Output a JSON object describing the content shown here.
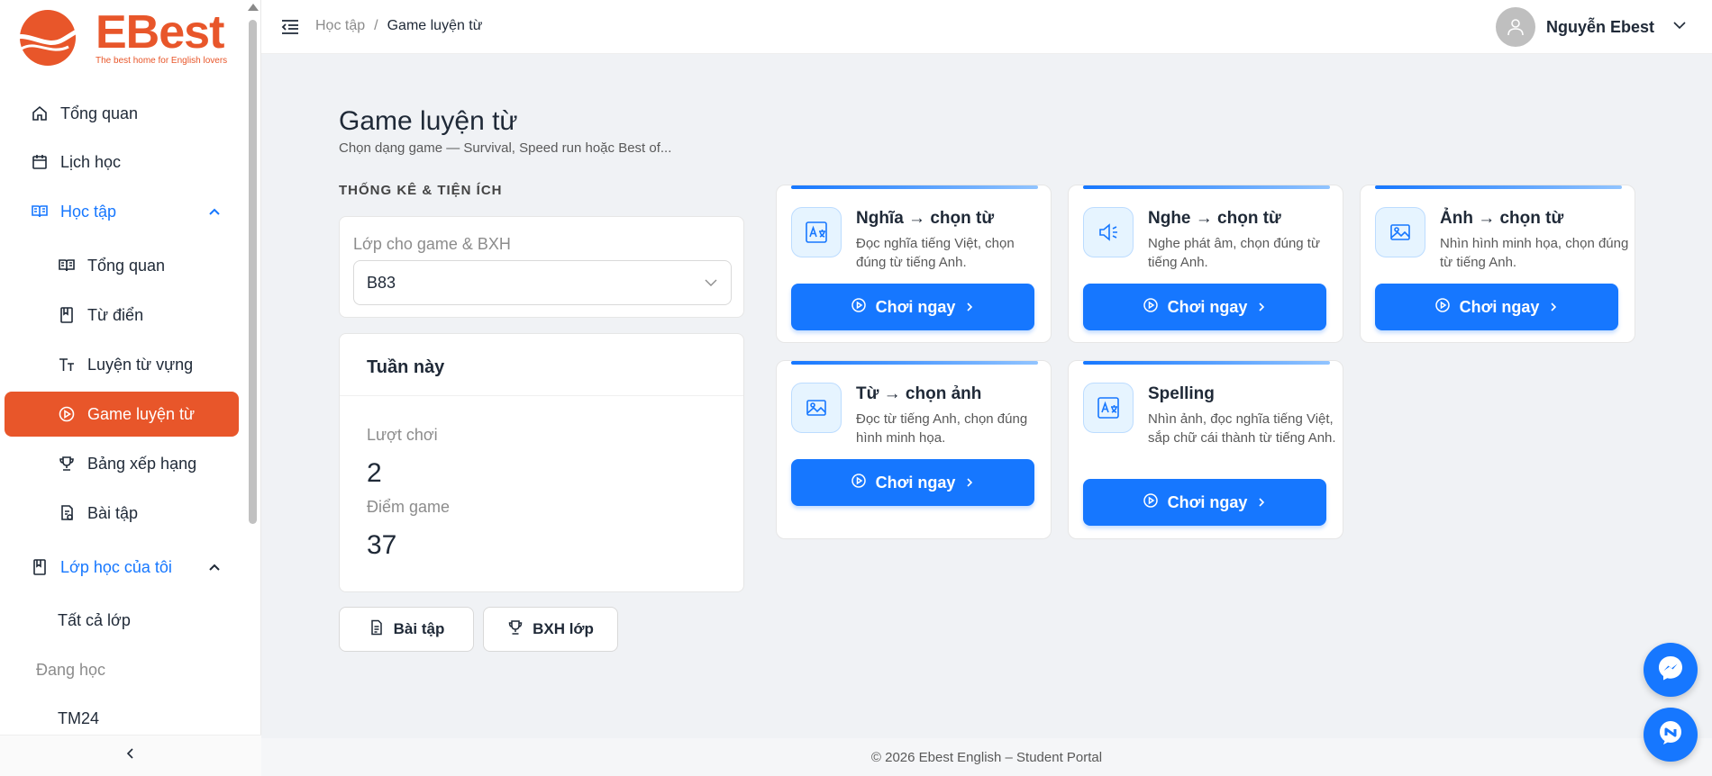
{
  "brand": {
    "name": "EBest",
    "tagline": "The best home for English lovers",
    "color": "#e8562a"
  },
  "sidebar": {
    "items": [
      {
        "label": "Tổng quan",
        "icon": "home-icon"
      },
      {
        "label": "Lịch học",
        "icon": "calendar-icon"
      },
      {
        "label": "Học tập",
        "icon": "book-open-icon",
        "expanded": true
      },
      {
        "label": "Tổng quan",
        "icon": "book-open-icon"
      },
      {
        "label": "Từ điển",
        "icon": "book-icon"
      },
      {
        "label": "Luyện từ vựng",
        "icon": "font-size-icon"
      },
      {
        "label": "Game luyện từ",
        "icon": "play-circle-icon",
        "active": true
      },
      {
        "label": "Bảng xếp hạng",
        "icon": "trophy-icon"
      },
      {
        "label": "Bài tập",
        "icon": "file-check-icon"
      },
      {
        "label": "Lớp học của tôi",
        "icon": "book-icon",
        "expanded": true
      },
      {
        "label": "Tất cả lớp"
      }
    ],
    "group_label": "Đang học",
    "classes": [
      "TM24"
    ]
  },
  "header": {
    "breadcrumb": [
      "Học tập",
      "Game luyện từ"
    ],
    "separator": "/",
    "user_name": "Nguyễn Ebest"
  },
  "main": {
    "title": "Game luyện từ",
    "subtitle": "Chọn dạng game — Survival, Speed run hoặc Best of...",
    "section_title": "THỐNG KÊ & TIỆN ÍCH",
    "class_select": {
      "label": "Lớp cho game & BXH",
      "value": "B83"
    },
    "week": {
      "title": "Tuần này",
      "plays_label": "Lượt chơi",
      "plays_value": "2",
      "score_label": "Điểm game",
      "score_value": "37"
    },
    "buttons": {
      "homework": "Bài tập",
      "class_ranking": "BXH lớp"
    }
  },
  "games": [
    {
      "title": "Nghĩa → chọn từ",
      "desc": "Đọc nghĩa tiếng Việt, chọn đúng từ tiếng Anh.",
      "icon": "translate-icon",
      "play": "Chơi ngay"
    },
    {
      "title": "Nghe → chọn từ",
      "desc": "Nghe phát âm, chọn đúng từ tiếng Anh.",
      "icon": "speaker-icon",
      "play": "Chơi ngay"
    },
    {
      "title": "Ảnh → chọn từ",
      "desc": "Nhìn hình minh họa, chọn đúng từ tiếng Anh.",
      "icon": "image-icon",
      "play": "Chơi ngay"
    },
    {
      "title": "Từ → chọn ảnh",
      "desc": "Đọc từ tiếng Anh, chọn đúng hình minh họa.",
      "icon": "image-icon",
      "play": "Chơi ngay"
    },
    {
      "title": "Spelling",
      "desc": "Nhìn ảnh, đọc nghĩa tiếng Việt, sắp chữ cái thành từ tiếng Anh.",
      "icon": "translate-icon",
      "play": "Chơi ngay"
    }
  ],
  "footer": {
    "text": "© 2026 Ebest English – Student Portal"
  },
  "colors": {
    "primary": "#1677ff",
    "active_menu": "#e8562a",
    "background": "#f0f2f5"
  }
}
